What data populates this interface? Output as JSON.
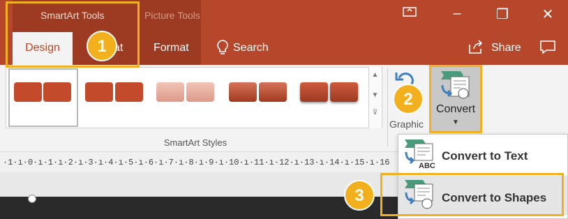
{
  "titlebar": {
    "context_group_label": "SmartArt Tools",
    "picture_group_label": "Picture Tools",
    "tabs": {
      "design": "Design",
      "format_partial": "at",
      "format": "Format",
      "search": "Search"
    },
    "share": "Share"
  },
  "ribbon": {
    "gallery_label": "SmartArt Styles",
    "graphics_label": "Graphic",
    "convert_label": "Convert"
  },
  "ruler": {
    "text": "·1·ı·0·ı·1·ı·2·ı·3·ı·4·ı·5·ı·6·ı·7·ı·8·ı·9·ı·10·ı·11·ı·12·ı·13·ı·14·ı·15·ı·16"
  },
  "dropdown": {
    "items": [
      {
        "label": "Convert to Text",
        "icon": "convert-to-text-icon",
        "icon_text": "ABC"
      },
      {
        "label": "Convert to Shapes",
        "icon": "convert-to-shapes-icon"
      }
    ]
  },
  "badges": {
    "step1": "1",
    "step2": "2",
    "step3": "3"
  },
  "colors": {
    "accent": "#b7472a",
    "highlight": "#f0b020"
  }
}
